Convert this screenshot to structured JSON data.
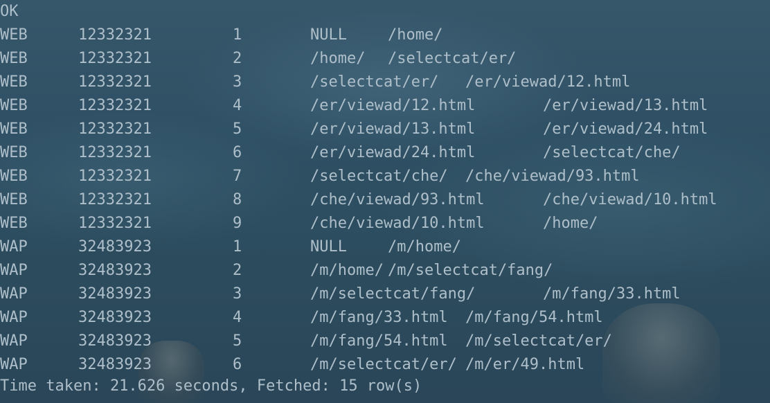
{
  "terminal": {
    "status_line": "OK",
    "rows": [
      {
        "type": "WEB",
        "id": "12332321",
        "seq": "1",
        "from": "NULL",
        "to": "/home/"
      },
      {
        "type": "WEB",
        "id": "12332321",
        "seq": "2",
        "from": "/home/",
        "to": "/selectcat/er/"
      },
      {
        "type": "WEB",
        "id": "12332321",
        "seq": "3",
        "from": "/selectcat/er/",
        "to": "/er/viewad/12.html"
      },
      {
        "type": "WEB",
        "id": "12332321",
        "seq": "4",
        "from": "/er/viewad/12.html",
        "to": "/er/viewad/13.html"
      },
      {
        "type": "WEB",
        "id": "12332321",
        "seq": "5",
        "from": "/er/viewad/13.html",
        "to": "/er/viewad/24.html"
      },
      {
        "type": "WEB",
        "id": "12332321",
        "seq": "6",
        "from": "/er/viewad/24.html",
        "to": "/selectcat/che/"
      },
      {
        "type": "WEB",
        "id": "12332321",
        "seq": "7",
        "from": "/selectcat/che/",
        "to": "/che/viewad/93.html"
      },
      {
        "type": "WEB",
        "id": "12332321",
        "seq": "8",
        "from": "/che/viewad/93.html",
        "to": "/che/viewad/10.html"
      },
      {
        "type": "WEB",
        "id": "12332321",
        "seq": "9",
        "from": "/che/viewad/10.html",
        "to": "/home/"
      },
      {
        "type": "WAP",
        "id": "32483923",
        "seq": "1",
        "from": "NULL",
        "to": "/m/home/"
      },
      {
        "type": "WAP",
        "id": "32483923",
        "seq": "2",
        "from": "/m/home/",
        "to": "/m/selectcat/fang/"
      },
      {
        "type": "WAP",
        "id": "32483923",
        "seq": "3",
        "from": "/m/selectcat/fang/",
        "to": "/m/fang/33.html"
      },
      {
        "type": "WAP",
        "id": "32483923",
        "seq": "4",
        "from": "/m/fang/33.html",
        "to": "/m/fang/54.html"
      },
      {
        "type": "WAP",
        "id": "32483923",
        "seq": "5",
        "from": "/m/fang/54.html",
        "to": "/m/selectcat/er/"
      },
      {
        "type": "WAP",
        "id": "32483923",
        "seq": "6",
        "from": "/m/selectcat/er/",
        "to": "/m/er/49.html"
      }
    ],
    "footer": "Time taken: 21.626 seconds, Fetched: 15 row(s)"
  },
  "colors": {
    "text": "#aebfca",
    "background": "#2f5064"
  }
}
